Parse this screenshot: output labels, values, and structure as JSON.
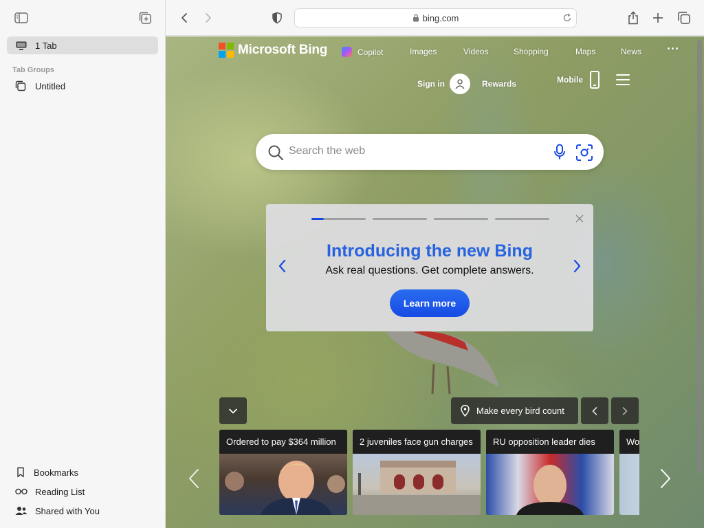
{
  "sidebar": {
    "tab_label": "1 Tab",
    "tab_groups_heading": "Tab Groups",
    "group_label": "Untitled",
    "bookmarks_label": "Bookmarks",
    "reading_list_label": "Reading List",
    "shared_label": "Shared with You"
  },
  "toolbar": {
    "url": "bing.com"
  },
  "bing": {
    "logo_text": "Microsoft Bing",
    "nav": [
      "Copilot",
      "Images",
      "Videos",
      "Shopping",
      "Maps",
      "News"
    ],
    "more": "···",
    "sign_in": "Sign in",
    "rewards": "Rewards",
    "mobile": "Mobile",
    "search_placeholder": "Search the web"
  },
  "promo": {
    "title": "Introducing the new Bing",
    "subtitle": "Ask real questions. Get complete answers.",
    "cta": "Learn more"
  },
  "bottom": {
    "location_text": "Make every bird count",
    "cards": [
      {
        "caption": "Ordered to pay $364 million"
      },
      {
        "caption": "2 juveniles face gun charges"
      },
      {
        "caption": "RU opposition leader dies"
      },
      {
        "caption": "Wor"
      }
    ]
  },
  "colors": {
    "accent_blue": "#174ae4",
    "promo_title": "#2763df"
  }
}
